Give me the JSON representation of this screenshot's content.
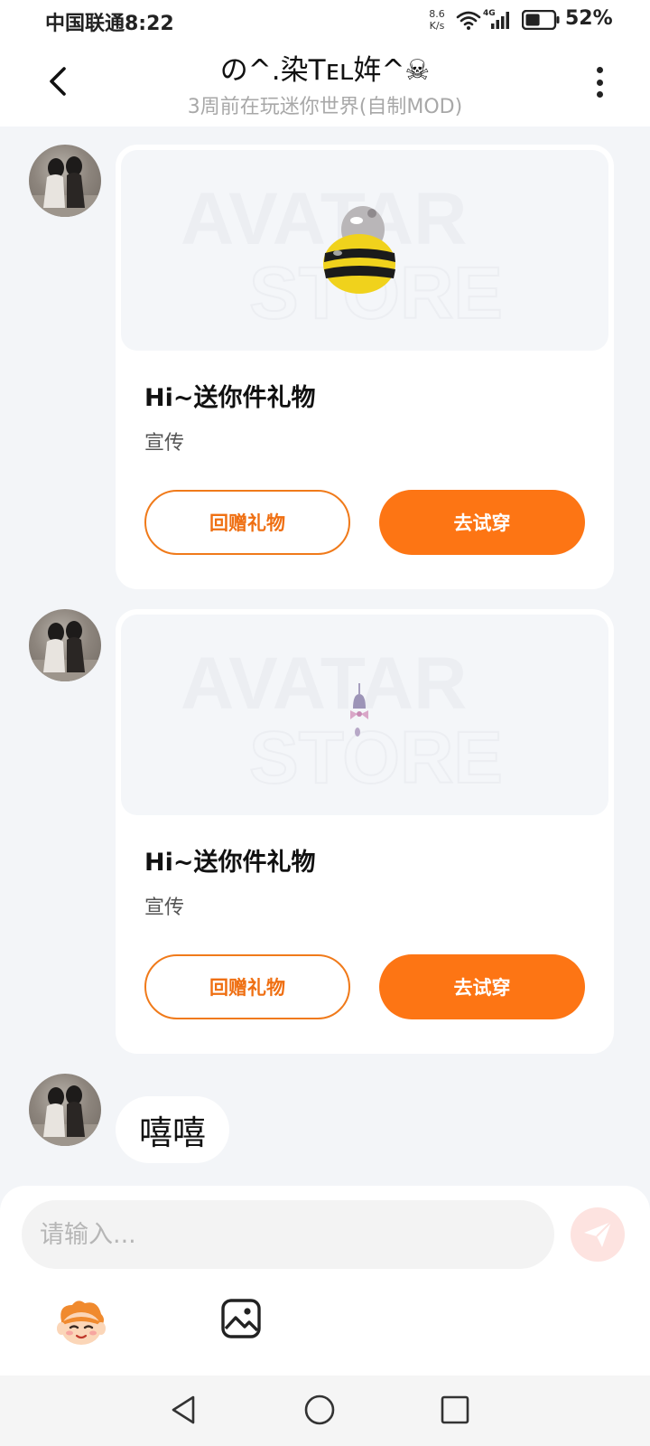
{
  "status_bar": {
    "carrier_time": "中国联通8:22",
    "net_speed_value": "8.6",
    "net_speed_unit": "K/s",
    "signal_label": "4G",
    "battery": "52%",
    "battery_level": 0.52,
    "icons": [
      "wifi-icon",
      "signal-icon",
      "battery-icon"
    ]
  },
  "header": {
    "title": "の^.染Tᴇʟ姩^☠",
    "subtitle": "3周前在玩迷你世界(自制MOD)",
    "icons": [
      "back-arrow-icon",
      "more-vertical-icon"
    ]
  },
  "messages": [
    {
      "type": "gift",
      "preview_watermark": [
        "AVATAR",
        "STORE"
      ],
      "item_icon": "bee-costume-icon",
      "title": "Hi~送你件礼物",
      "subtitle": "宣传",
      "return_label": "回赠礼物",
      "try_label": "去试穿"
    },
    {
      "type": "gift",
      "preview_watermark": [
        "AVATAR",
        "STORE"
      ],
      "item_icon": "bell-ornament-icon",
      "title": "Hi~送你件礼物",
      "subtitle": "宣传",
      "return_label": "回赠礼物",
      "try_label": "去试穿"
    },
    {
      "type": "text",
      "text": "嘻嘻"
    }
  ],
  "input": {
    "placeholder": "请输入...",
    "value": ""
  },
  "toolbar": {
    "icons": [
      "emoji-mascot-icon",
      "image-icon",
      "send-icon"
    ]
  },
  "nav_bar": {
    "icons": [
      "nav-back-icon",
      "nav-home-icon",
      "nav-recents-icon"
    ]
  },
  "colors": {
    "accent": "#fd7514",
    "accent_outline": "#f07a1a",
    "background": "#f3f5f8",
    "card": "#ffffff",
    "send_button_bg": "#fde3e0"
  }
}
